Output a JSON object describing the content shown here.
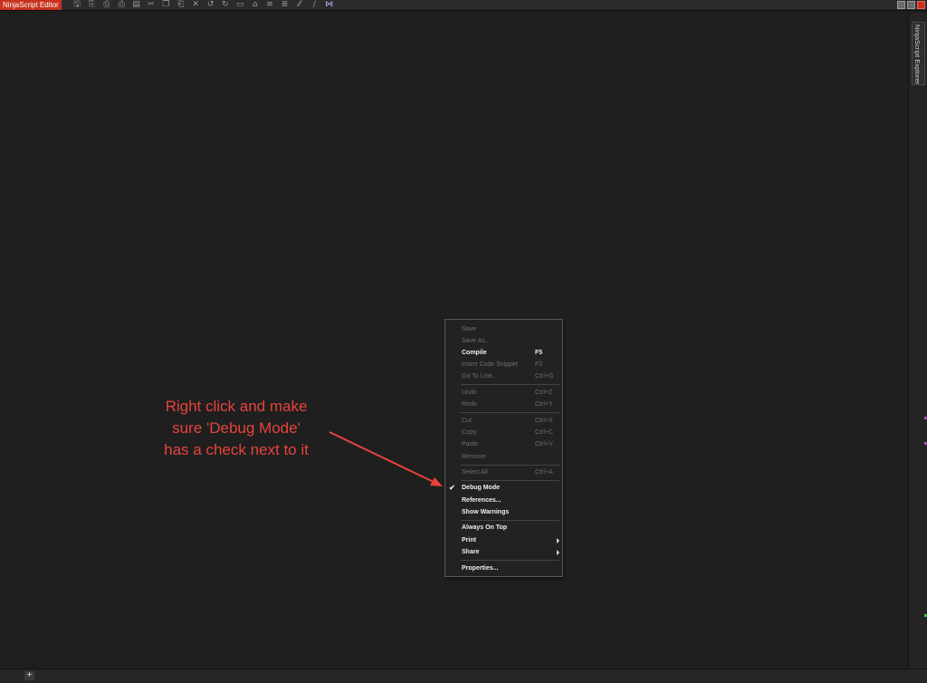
{
  "window": {
    "title": "NinjaScript Editor"
  },
  "toolbar": {
    "buttons": [
      {
        "name": "save-icon",
        "glyph": "🖫"
      },
      {
        "name": "save-all-icon",
        "glyph": "⎘"
      },
      {
        "name": "print-preview-icon",
        "glyph": "⎙"
      },
      {
        "name": "print-icon",
        "glyph": "⎙"
      },
      {
        "name": "compile-icon",
        "glyph": "▤"
      },
      {
        "name": "cut-icon",
        "glyph": "✂"
      },
      {
        "name": "copy-icon",
        "glyph": "❐"
      },
      {
        "name": "paste-icon",
        "glyph": "⎗"
      },
      {
        "name": "remove-icon",
        "glyph": "✕"
      },
      {
        "name": "undo-icon",
        "glyph": "↺"
      },
      {
        "name": "redo-icon",
        "glyph": "↻"
      },
      {
        "name": "page-icon",
        "glyph": "▭"
      },
      {
        "name": "insert-snippet-icon",
        "glyph": "⌂"
      },
      {
        "name": "indent-icon",
        "glyph": "≡"
      },
      {
        "name": "outdent-icon",
        "glyph": "≣"
      },
      {
        "name": "comment-icon",
        "glyph": "⁄⁄"
      },
      {
        "name": "uncomment-icon",
        "glyph": "/"
      },
      {
        "name": "visual-studio-icon",
        "glyph": "⋈"
      }
    ]
  },
  "side_panel": {
    "tab_label": "NinjaScript Explorer"
  },
  "bottom_bar": {
    "add_tab_label": "+"
  },
  "context_menu": {
    "items": [
      {
        "id": "save",
        "label": "Save",
        "shortcut": "",
        "enabled": false
      },
      {
        "id": "save-as",
        "label": "Save As...",
        "shortcut": "",
        "enabled": false
      },
      {
        "id": "compile",
        "label": "Compile",
        "shortcut": "F5",
        "enabled": true
      },
      {
        "id": "insert-code-snippet",
        "label": "Insert Code Snippet",
        "shortcut": "F2",
        "enabled": false
      },
      {
        "id": "go-to-line",
        "label": "Go To Line...",
        "shortcut": "Ctrl+G",
        "enabled": false
      },
      {
        "id": "undo",
        "label": "Undo",
        "shortcut": "Ctrl+Z",
        "enabled": false
      },
      {
        "id": "redo",
        "label": "Redo",
        "shortcut": "Ctrl+Y",
        "enabled": false
      },
      {
        "id": "cut",
        "label": "Cut",
        "shortcut": "Ctrl+X",
        "enabled": false
      },
      {
        "id": "copy",
        "label": "Copy",
        "shortcut": "Ctrl+C",
        "enabled": false
      },
      {
        "id": "paste",
        "label": "Paste",
        "shortcut": "Ctrl+V",
        "enabled": false
      },
      {
        "id": "remove",
        "label": "Remove",
        "shortcut": "",
        "enabled": false
      },
      {
        "id": "select-all",
        "label": "Select All",
        "shortcut": "Ctrl+A",
        "enabled": false
      },
      {
        "id": "debug-mode",
        "label": "Debug Mode",
        "shortcut": "",
        "enabled": true,
        "checked": true
      },
      {
        "id": "references",
        "label": "References...",
        "shortcut": "",
        "enabled": true
      },
      {
        "id": "show-warnings",
        "label": "Show Warnings",
        "shortcut": "",
        "enabled": true
      },
      {
        "id": "always-on-top",
        "label": "Always On Top",
        "shortcut": "",
        "enabled": true
      },
      {
        "id": "print",
        "label": "Print",
        "shortcut": "",
        "enabled": true,
        "submenu": true
      },
      {
        "id": "share",
        "label": "Share",
        "shortcut": "",
        "enabled": true,
        "submenu": true
      },
      {
        "id": "properties",
        "label": "Properties...",
        "shortcut": "",
        "enabled": true
      }
    ],
    "check_glyph": "✔"
  },
  "annotation": {
    "lines": [
      "Right click and make",
      "sure 'Debug Mode'",
      "has a check next to it"
    ],
    "color": "#e8433c"
  },
  "colors": {
    "background": "#1e1e1e",
    "title_tab": "#c8321e",
    "menu_enabled_text": "#f0f0f0",
    "menu_disabled_text": "#6e6e6e"
  }
}
